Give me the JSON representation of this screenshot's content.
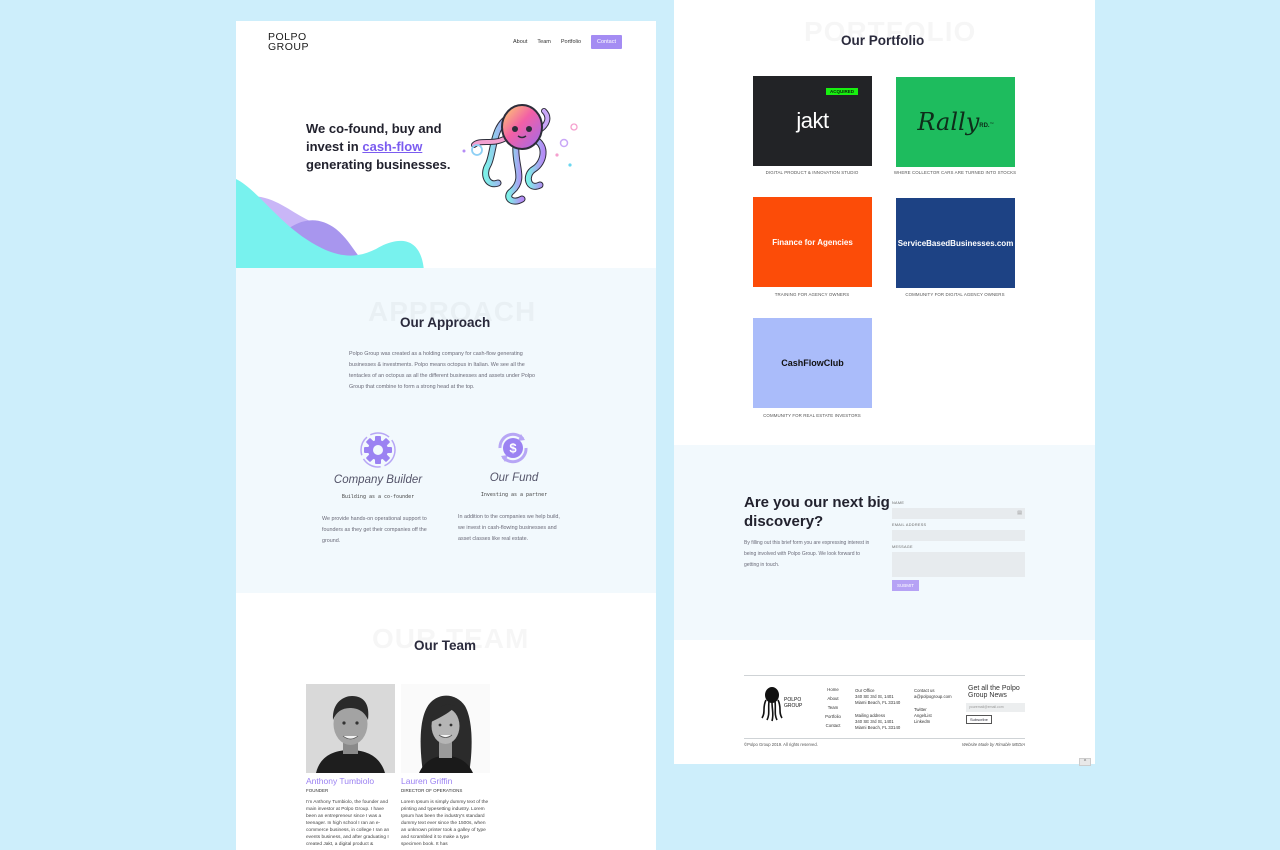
{
  "header": {
    "logo_line1": "POLPO",
    "logo_line2": "GROUP",
    "nav": [
      "About",
      "Team",
      "Portfolio"
    ],
    "cta": "Contact"
  },
  "hero": {
    "line1": "We co-found, buy and",
    "line2_prefix": "invest in ",
    "line2_highlight": "cash-flow",
    "line3": "generating businesses."
  },
  "approach": {
    "ghost": "APPROACH",
    "title": "Our Approach",
    "text": "Polpo Group was created as a holding company for cash-flow generating businesses & investments. Polpo means octopus in Italian. We see all the tentacles of an octopus as all the different businesses and assets under Polpo Group that combine to form a strong head at the top.",
    "features": [
      {
        "title": "Company Builder",
        "sub": "Building as a co-founder",
        "desc": "We provide hands-on operational support to founders as they get their companies off the ground.",
        "icon": "gear-icon"
      },
      {
        "title": "Our Fund",
        "sub": "Investing as a partner",
        "desc": "In addition to the companies we help build, we invest in cash-flowing businesses and asset classes like real estate.",
        "icon": "dollar-cycle-icon"
      }
    ]
  },
  "team": {
    "ghost": "OUR TEAM",
    "title": "Our Team",
    "members": [
      {
        "name": "Anthony Tumbiolo",
        "role": "FOUNDER",
        "bio": "I'm Anthony Tumbiolo, the founder and main investor at Polpo Group. I have been an entrepreneur since I was a teenager. In high school I ran an e-commerce business, in college I ran an events business, and after graduating I created Jakt, a digital product &"
      },
      {
        "name": "Lauren Griffin",
        "role": "DIRECTOR OF OPERATIONS",
        "bio": "Lorem Ipsum is simply dummy text of the printing and typesetting industry. Lorem Ipsum has been the industry's standard dummy text ever since the 1500s, when an unknown printer took a galley of type and scrambled it to make a type specimen book. It has"
      }
    ]
  },
  "portfolio": {
    "ghost": "PORTFOLIO",
    "title": "Our Portfolio",
    "items": [
      {
        "name": "jakt",
        "caption": "DIGITAL PRODUCT & INNOVATION STUDIO",
        "badge": "ACQUIRED",
        "color": "#222326"
      },
      {
        "name": "Rally",
        "suffix": "RD.",
        "tm": "™",
        "caption": "WHERE COLLECTOR CARS ARE TURNED INTO STOCKS",
        "color": "#1ebc5e"
      },
      {
        "name": "Finance for Agencies",
        "caption": "TRAINING FOR AGENCY OWNERS",
        "color": "#fc4c08"
      },
      {
        "name": "ServiceBasedBusinesses.com",
        "caption": "COMMUNITY FOR DIGITAL AGENCY OWNERS",
        "color": "#1d4284"
      },
      {
        "name": "CashFlowClub",
        "caption": "COMMUNITY FOR REAL ESTATE INVESTORS",
        "color": "#aabcfa"
      }
    ]
  },
  "discovery": {
    "title": "Are you our next big discovery?",
    "text": "By filling out this brief form you are expressing interest in being involved with Polpo Group. We look forward to getting in touch.",
    "name_label": "NAME",
    "email_label": "EMAIL ADDRESS",
    "message_label": "MESSAGE",
    "submit": "SUBMIT"
  },
  "footer": {
    "logo_line1": "POLPO",
    "logo_line2": "GROUP",
    "links": [
      "Home",
      "About",
      "Team",
      "Portfolio",
      "Contact"
    ],
    "office_label": "Our Office",
    "office_addr1": "340 SE 3rd St, 1401",
    "office_addr2": "Miami Beach, FL 33140",
    "mail_label": "Mailing address",
    "mail_addr1": "340 SE 3rd St, 1401",
    "mail_addr2": "Miami Beach, FL 33140",
    "contact_label": "Contact us",
    "contact_email": "a@polpogroup.com",
    "socials": [
      "Twitter",
      "AngelList",
      "LinkedIn"
    ],
    "news_title": "Get all the Polpo Group News",
    "news_placeholder": "youremail@email.com",
    "news_btn": "Subscribe",
    "copyright": "©Polpo Group 2019. All rights reserved.",
    "credit": "Website Made by Rimable MEDIA"
  },
  "scroll_top": "^"
}
